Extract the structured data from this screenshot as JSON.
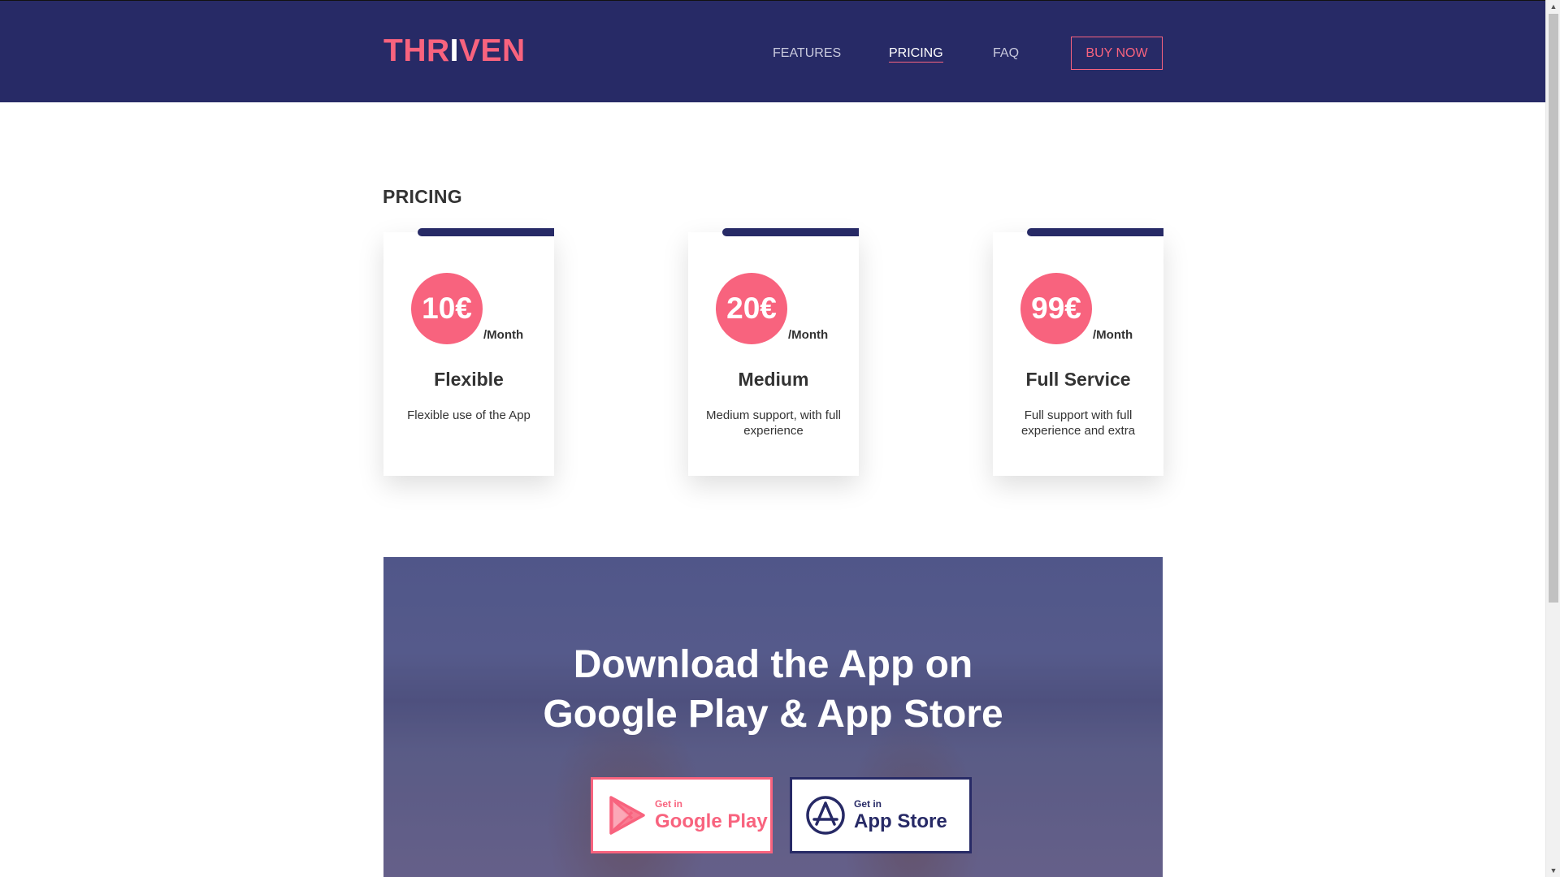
{
  "header": {
    "logo": {
      "part1": "THR",
      "part2": "I",
      "part3": "VEN"
    },
    "nav": {
      "features": "FEATURES",
      "pricing": "PRICING",
      "faq": "FAQ"
    },
    "buy_label": "BUY NOW"
  },
  "pricing": {
    "title": "PRICING",
    "plans": [
      {
        "price": "10€",
        "period": "/Month",
        "name": "Flexible",
        "description": "Flexible use of the App"
      },
      {
        "price": "20€",
        "period": "/Month",
        "name": "Medium",
        "description": "Medium support, with full experience"
      },
      {
        "price": "99€",
        "period": "/Month",
        "name": "Full Service",
        "description": "Full support with full experience and extra"
      }
    ]
  },
  "download": {
    "title_line1": "Download the App on",
    "title_line2": "Google Play & App Store",
    "google": {
      "small": "Get in",
      "big": "Google Play"
    },
    "apple": {
      "small": "Get in",
      "big": "App Store"
    }
  },
  "colors": {
    "navy": "#272a66",
    "pink": "#f8637e"
  },
  "icons": {
    "google": "google-play-icon",
    "apple": "app-store-icon"
  }
}
